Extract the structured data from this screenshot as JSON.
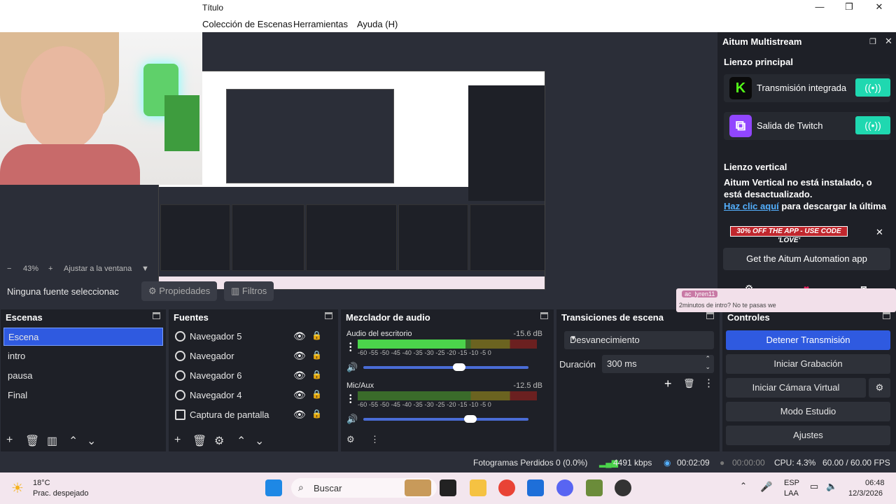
{
  "window": {
    "title": "Título"
  },
  "menu": [
    "Colección de Escenas",
    "Herramientas",
    "Ayuda (H)"
  ],
  "zoom": {
    "minus": "−",
    "percent": "43%",
    "plus": "+",
    "fit": "Ajustar a la ventana"
  },
  "source_toolbar": {
    "no_selection": "Ninguna fuente seleccionac",
    "properties": "Propiedades",
    "filters": "Filtros"
  },
  "multistream": {
    "title": "Aitum Multistream",
    "main_canvas": "Lienzo principal",
    "services": [
      {
        "name": "Transmisión integrada",
        "logo": "K",
        "color": "#0a0a0a",
        "accent": "#53fc18"
      },
      {
        "name": "Salida de Twitch",
        "logo": "⧉",
        "color": "#9146ff",
        "accent": "#ffffff"
      }
    ],
    "vertical_title": "Lienzo vertical",
    "vertical_msg": "Aitum Vertical no está instalado, o está desactualizado.",
    "vertical_link": "Haz clic aquí",
    "vertical_after": "para descargar la última",
    "promo": "30% OFF THE APP - USE CODE 'LOVE'",
    "automation_btn": "Get the Aitum Automation app"
  },
  "chat_popup": {
    "user": "ac_lyren11",
    "message": "2minutos de intro? No te pasas we"
  },
  "scenes": {
    "title": "Escenas",
    "items": [
      "Escena",
      "intro",
      "pausa",
      "Final"
    ],
    "active": 0
  },
  "sources": {
    "title": "Fuentes",
    "items": [
      {
        "label": "Navegador 5",
        "kind": "browser"
      },
      {
        "label": "Navegador",
        "kind": "browser"
      },
      {
        "label": "Navegador 6",
        "kind": "browser"
      },
      {
        "label": "Navegador 4",
        "kind": "browser"
      },
      {
        "label": "Captura de pantalla",
        "kind": "screen"
      }
    ]
  },
  "mixer": {
    "title": "Mezclador de audio",
    "channels": [
      {
        "name": "Audio del escritorio",
        "db": "-15.6 dB",
        "level": 0.6,
        "volume": 0.58
      },
      {
        "name": "Mic/Aux",
        "db": "-12.5 dB",
        "level": 0.0,
        "volume": 0.65
      }
    ],
    "ticks": "-60  -55  -50  -45  -40  -35  -30  -25  -20  -15  -10   -5    0"
  },
  "transitions": {
    "title": "Transiciones de escena",
    "selected": "Desvanecimiento",
    "duration_label": "Duración",
    "duration": "300 ms"
  },
  "controls": {
    "title": "Controles",
    "buttons": [
      "Detener Transmisión",
      "Iniciar Grabación",
      "Iniciar Cámara Virtual",
      "Modo Estudio",
      "Ajustes"
    ]
  },
  "status": {
    "dropped": "Fotogramas Perdidos 0 (0.0%)",
    "bitrate": "4491 kbps",
    "stream_time": "00:02:09",
    "rec_time": "00:00:00",
    "cpu": "CPU: 4.3%",
    "fps": "60.00 / 60.00 FPS"
  },
  "taskbar": {
    "weather_temp": "18°C",
    "weather_desc": "Prac. despejado",
    "search": "Buscar",
    "lang1": "ESP",
    "lang2": "LAA",
    "time": "06:48",
    "date": "12/3/2026"
  }
}
